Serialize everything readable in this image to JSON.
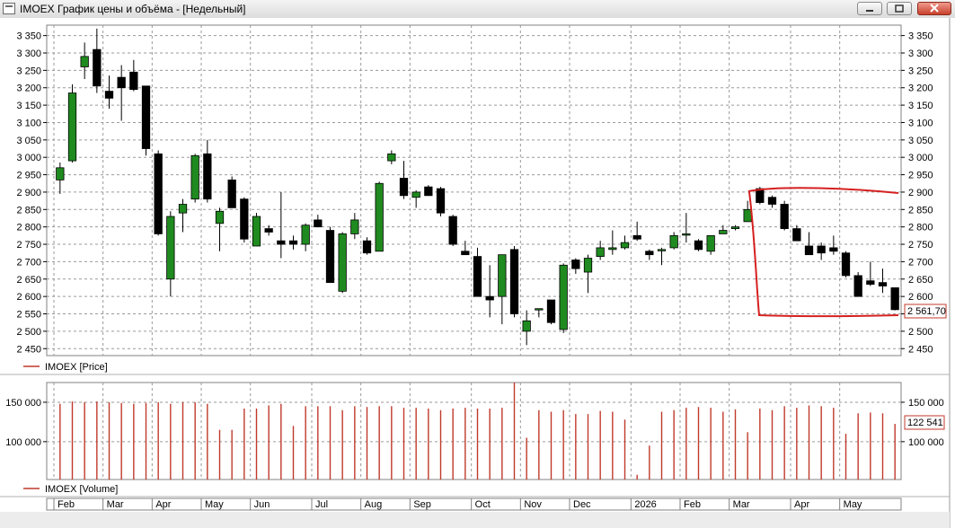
{
  "window": {
    "title": "IMOEX График цены и объёма - [Недельный]",
    "controls": [
      "minimize",
      "maximize",
      "close"
    ]
  },
  "chart_data": [
    {
      "type": "candlestick",
      "name": "price",
      "legend": "IMOEX [Price]",
      "ylim": [
        2430,
        3380
      ],
      "yticks": [
        "2 450",
        "2 500",
        "2 550",
        "2 600",
        "2 650",
        "2 700",
        "2 750",
        "2 800",
        "2 850",
        "2 900",
        "2 950",
        "3 000",
        "3 050",
        "3 100",
        "3 150",
        "3 200",
        "3 250",
        "3 300",
        "3 350"
      ],
      "ytick_values": [
        2450,
        2500,
        2550,
        2600,
        2650,
        2700,
        2750,
        2800,
        2850,
        2900,
        2950,
        3000,
        3050,
        3100,
        3150,
        3200,
        3250,
        3300,
        3350
      ],
      "last_price_label": "2 561,70",
      "up_color": "#1f8a1f",
      "down_color": "#000000",
      "last_label_color": "#c0392b",
      "grid": true,
      "candles": [
        {
          "o": 2935,
          "h": 2985,
          "l": 2895,
          "c": 2970
        },
        {
          "o": 2990,
          "h": 3210,
          "l": 2985,
          "c": 3185
        },
        {
          "o": 3260,
          "h": 3330,
          "l": 3225,
          "c": 3290
        },
        {
          "o": 3310,
          "h": 3370,
          "l": 3185,
          "c": 3205
        },
        {
          "o": 3190,
          "h": 3235,
          "l": 3140,
          "c": 3170
        },
        {
          "o": 3230,
          "h": 3265,
          "l": 3105,
          "c": 3200
        },
        {
          "o": 3245,
          "h": 3280,
          "l": 3190,
          "c": 3195
        },
        {
          "o": 3205,
          "h": 3205,
          "l": 3005,
          "c": 3025
        },
        {
          "o": 3010,
          "h": 3020,
          "l": 2775,
          "c": 2780
        },
        {
          "o": 2650,
          "h": 2845,
          "l": 2600,
          "c": 2830
        },
        {
          "o": 2840,
          "h": 2880,
          "l": 2785,
          "c": 2865
        },
        {
          "o": 2880,
          "h": 3010,
          "l": 2870,
          "c": 3005
        },
        {
          "o": 3010,
          "h": 3050,
          "l": 2870,
          "c": 2880
        },
        {
          "o": 2810,
          "h": 2855,
          "l": 2730,
          "c": 2845
        },
        {
          "o": 2935,
          "h": 2945,
          "l": 2855,
          "c": 2855
        },
        {
          "o": 2880,
          "h": 2885,
          "l": 2755,
          "c": 2765
        },
        {
          "o": 2745,
          "h": 2840,
          "l": 2745,
          "c": 2830
        },
        {
          "o": 2795,
          "h": 2805,
          "l": 2775,
          "c": 2785
        },
        {
          "o": 2760,
          "h": 2900,
          "l": 2710,
          "c": 2750
        },
        {
          "o": 2760,
          "h": 2775,
          "l": 2735,
          "c": 2750
        },
        {
          "o": 2750,
          "h": 2810,
          "l": 2730,
          "c": 2805
        },
        {
          "o": 2820,
          "h": 2835,
          "l": 2800,
          "c": 2800
        },
        {
          "o": 2790,
          "h": 2800,
          "l": 2645,
          "c": 2640
        },
        {
          "o": 2615,
          "h": 2785,
          "l": 2610,
          "c": 2780
        },
        {
          "o": 2780,
          "h": 2840,
          "l": 2765,
          "c": 2820
        },
        {
          "o": 2760,
          "h": 2770,
          "l": 2720,
          "c": 2725
        },
        {
          "o": 2730,
          "h": 2930,
          "l": 2730,
          "c": 2925
        },
        {
          "o": 2990,
          "h": 3020,
          "l": 2980,
          "c": 3010
        },
        {
          "o": 2940,
          "h": 2990,
          "l": 2880,
          "c": 2890
        },
        {
          "o": 2885,
          "h": 2905,
          "l": 2855,
          "c": 2900
        },
        {
          "o": 2915,
          "h": 2920,
          "l": 2890,
          "c": 2890
        },
        {
          "o": 2910,
          "h": 2915,
          "l": 2830,
          "c": 2840
        },
        {
          "o": 2830,
          "h": 2835,
          "l": 2745,
          "c": 2750
        },
        {
          "o": 2730,
          "h": 2760,
          "l": 2720,
          "c": 2720
        },
        {
          "o": 2715,
          "h": 2740,
          "l": 2600,
          "c": 2600
        },
        {
          "o": 2600,
          "h": 2690,
          "l": 2540,
          "c": 2590
        },
        {
          "o": 2600,
          "h": 2720,
          "l": 2520,
          "c": 2720
        },
        {
          "o": 2735,
          "h": 2745,
          "l": 2540,
          "c": 2550
        },
        {
          "o": 2500,
          "h": 2560,
          "l": 2460,
          "c": 2530
        },
        {
          "o": 2565,
          "h": 2565,
          "l": 2540,
          "c": 2565
        },
        {
          "o": 2590,
          "h": 2590,
          "l": 2520,
          "c": 2525
        },
        {
          "o": 2505,
          "h": 2695,
          "l": 2495,
          "c": 2690
        },
        {
          "o": 2705,
          "h": 2710,
          "l": 2665,
          "c": 2680
        },
        {
          "o": 2670,
          "h": 2720,
          "l": 2610,
          "c": 2710
        },
        {
          "o": 2715,
          "h": 2760,
          "l": 2705,
          "c": 2740
        },
        {
          "o": 2735,
          "h": 2790,
          "l": 2720,
          "c": 2740
        },
        {
          "o": 2740,
          "h": 2775,
          "l": 2735,
          "c": 2755
        },
        {
          "o": 2775,
          "h": 2815,
          "l": 2760,
          "c": 2765
        },
        {
          "o": 2730,
          "h": 2735,
          "l": 2705,
          "c": 2720
        },
        {
          "o": 2735,
          "h": 2740,
          "l": 2690,
          "c": 2735
        },
        {
          "o": 2740,
          "h": 2785,
          "l": 2735,
          "c": 2775
        },
        {
          "o": 2780,
          "h": 2840,
          "l": 2755,
          "c": 2780
        },
        {
          "o": 2760,
          "h": 2765,
          "l": 2730,
          "c": 2735
        },
        {
          "o": 2730,
          "h": 2775,
          "l": 2720,
          "c": 2775
        },
        {
          "o": 2780,
          "h": 2805,
          "l": 2780,
          "c": 2790
        },
        {
          "o": 2795,
          "h": 2805,
          "l": 2790,
          "c": 2800
        },
        {
          "o": 2815,
          "h": 2875,
          "l": 2815,
          "c": 2850
        },
        {
          "o": 2910,
          "h": 2915,
          "l": 2865,
          "c": 2870
        },
        {
          "o": 2885,
          "h": 2890,
          "l": 2855,
          "c": 2865
        },
        {
          "o": 2865,
          "h": 2875,
          "l": 2790,
          "c": 2795
        },
        {
          "o": 2795,
          "h": 2805,
          "l": 2760,
          "c": 2760
        },
        {
          "o": 2745,
          "h": 2785,
          "l": 2720,
          "c": 2720
        },
        {
          "o": 2745,
          "h": 2755,
          "l": 2705,
          "c": 2725
        },
        {
          "o": 2740,
          "h": 2775,
          "l": 2720,
          "c": 2730
        },
        {
          "o": 2725,
          "h": 2730,
          "l": 2655,
          "c": 2660
        },
        {
          "o": 2660,
          "h": 2670,
          "l": 2600,
          "c": 2600
        },
        {
          "o": 2645,
          "h": 2700,
          "l": 2630,
          "c": 2635
        },
        {
          "o": 2640,
          "h": 2680,
          "l": 2610,
          "c": 2630
        },
        {
          "o": 2625,
          "h": 2625,
          "l": 2560,
          "c": 2562
        }
      ]
    },
    {
      "type": "bar",
      "name": "volume",
      "legend": "IMOEX [Volume]",
      "ylim": [
        52000,
        175000
      ],
      "yticks": [
        "100 000",
        "150 000"
      ],
      "ytick_values": [
        100000,
        150000
      ],
      "last_value_label": "122 541",
      "bar_color": "#c0392b",
      "values": [
        148000,
        151000,
        150000,
        151000,
        150000,
        149000,
        148000,
        149000,
        150000,
        148000,
        150000,
        150000,
        148000,
        115000,
        115000,
        142000,
        142000,
        146000,
        148000,
        120000,
        145000,
        145000,
        145000,
        140000,
        145000,
        144000,
        145000,
        145000,
        143000,
        143000,
        142000,
        140000,
        142000,
        143000,
        142000,
        142000,
        143000,
        175000,
        105000,
        140000,
        138000,
        140000,
        135000,
        135000,
        139000,
        138000,
        128000,
        58000,
        95000,
        138000,
        140000,
        143000,
        144000,
        143000,
        138000,
        141000,
        112000,
        142000,
        140000,
        145000,
        143000,
        146000,
        145000,
        143000,
        110000,
        136000,
        137000,
        136000,
        122541
      ]
    }
  ],
  "x_axis": {
    "months": [
      "Feb",
      "Mar",
      "Apr",
      "May",
      "Jun",
      "Jul",
      "Aug",
      "Sep",
      "Oct",
      "Nov",
      "Dec",
      "2026",
      "Feb",
      "Mar",
      "Apr",
      "May"
    ],
    "month_start_index": [
      0,
      4,
      8,
      12,
      16,
      21,
      25,
      29,
      34,
      38,
      42,
      47,
      51,
      55,
      60,
      64
    ]
  },
  "annotation": {
    "type": "freehand-rectangle",
    "color": "#d62020"
  }
}
